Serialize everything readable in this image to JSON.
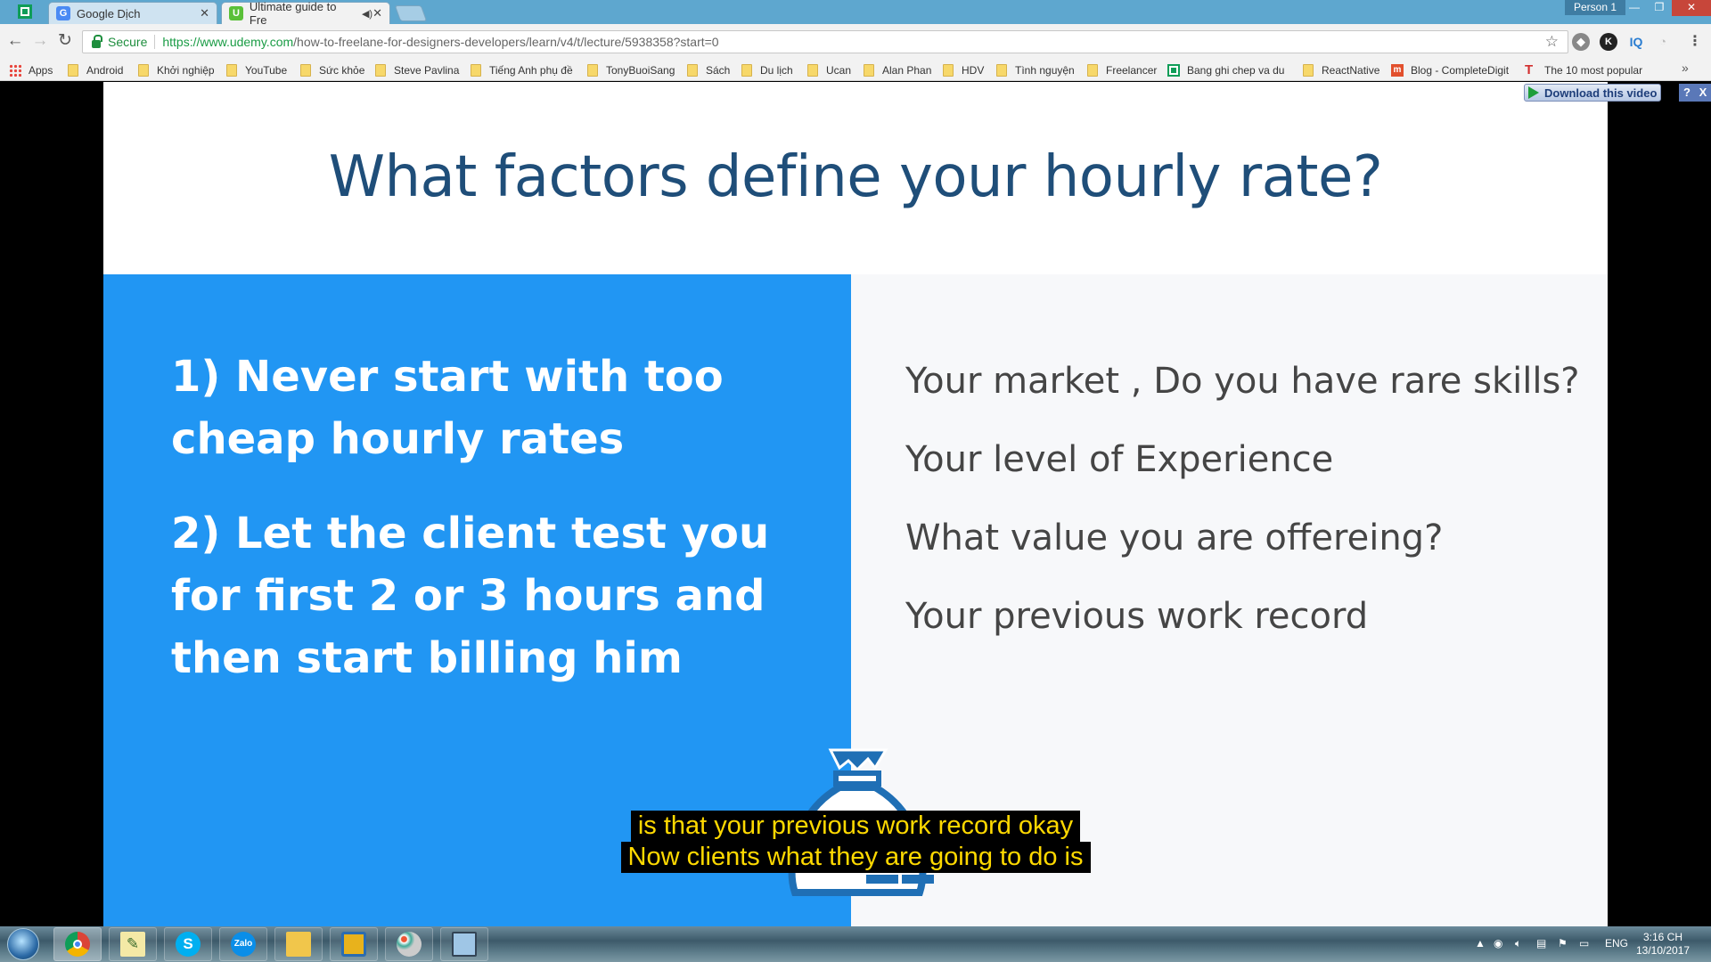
{
  "browser": {
    "tabs": [
      {
        "title": "Google Dịch",
        "active": false
      },
      {
        "title": "Ultimate guide to Fre",
        "active": true
      }
    ],
    "profile": "Person 1",
    "window_controls": [
      "minimize",
      "restore",
      "close"
    ],
    "secure_label": "Secure",
    "url_base": "https://www.udemy.com",
    "url_rest": "/how-to-freelane-for-designers-developers/learn/v4/t/lecture/5938358?start=0",
    "bookmarks": [
      {
        "label": "Apps",
        "icon": "apps-grid-icon"
      },
      {
        "label": "Android",
        "icon": "folder-icon"
      },
      {
        "label": "Khởi nghiệp",
        "icon": "folder-icon"
      },
      {
        "label": "YouTube",
        "icon": "folder-icon"
      },
      {
        "label": "Sức khỏe",
        "icon": "folder-icon"
      },
      {
        "label": "Steve Pavlina",
        "icon": "folder-icon"
      },
      {
        "label": "Tiếng Anh phụ đề",
        "icon": "folder-icon"
      },
      {
        "label": "TonyBuoiSang",
        "icon": "folder-icon"
      },
      {
        "label": "Sách",
        "icon": "folder-icon"
      },
      {
        "label": "Du lịch",
        "icon": "folder-icon"
      },
      {
        "label": "Ucan",
        "icon": "folder-icon"
      },
      {
        "label": "Alan Phan",
        "icon": "folder-icon"
      },
      {
        "label": "HDV",
        "icon": "folder-icon"
      },
      {
        "label": "Tình nguyện",
        "icon": "folder-icon"
      },
      {
        "label": "Freelancer",
        "icon": "folder-icon"
      },
      {
        "label": "Bang ghi chep va du",
        "icon": "sheets-icon"
      },
      {
        "label": "ReactNative",
        "icon": "folder-icon"
      },
      {
        "label": "Blog - CompleteDigit",
        "icon": "blog-icon"
      },
      {
        "label": "The 10 most popular",
        "icon": "t-icon"
      }
    ],
    "bookmarks_more": "»",
    "download_video": "Download this video",
    "download_help": "?",
    "download_close": "X"
  },
  "slide": {
    "title": "What factors define your hourly rate?",
    "points": [
      "1) Never start with too cheap hourly rates",
      "2) Let the client test you for first 2 or 3 hours and then start billing him"
    ],
    "factors": [
      "Your market , Do you have rare skills?",
      "Your level of Experience",
      "What value you are offereing?",
      "Your previous work record"
    ],
    "colors": {
      "title": "#1f4e79",
      "left_panel": "#2196f3",
      "right_panel": "#f7f8fa"
    }
  },
  "subtitle": {
    "line1": "is that your previous work record okay",
    "line2": "Now clients what they are going to do is"
  },
  "taskbar": {
    "apps": [
      "chrome-icon",
      "notepad-icon",
      "skype-icon",
      "zalo-icon",
      "file-explorer-icon",
      "app-icon",
      "paint-icon",
      "screenshot-icon"
    ],
    "zalo_label": "Zalo",
    "skype_label": "S",
    "language": "ENG",
    "time": "3:16 CH",
    "date": "13/10/2017"
  }
}
